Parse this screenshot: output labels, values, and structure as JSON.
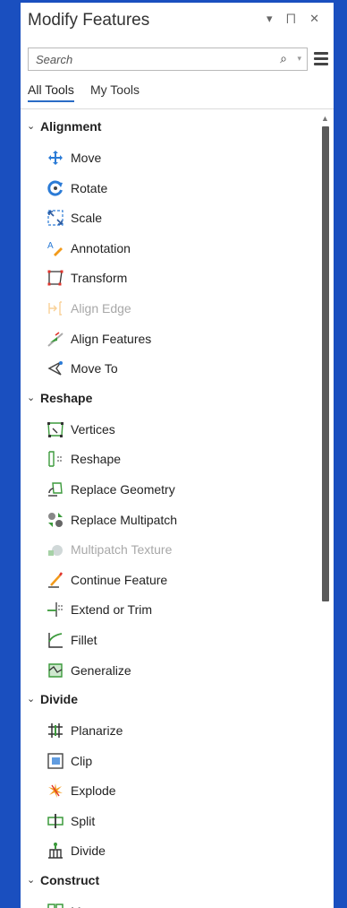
{
  "pane": {
    "title": "Modify Features",
    "title_controls": "▾ ⨅ ✕"
  },
  "search": {
    "placeholder": "Search",
    "search_glyph": "⌕",
    "drop_glyph": "▾"
  },
  "tabs": [
    {
      "label": "All Tools",
      "active": true
    },
    {
      "label": "My Tools",
      "active": false
    }
  ],
  "groups": [
    {
      "label": "Alignment",
      "items": [
        {
          "label": "Move",
          "icon": "move-icon",
          "disabled": false
        },
        {
          "label": "Rotate",
          "icon": "rotate-icon",
          "disabled": false
        },
        {
          "label": "Scale",
          "icon": "scale-icon",
          "disabled": false
        },
        {
          "label": "Annotation",
          "icon": "annotation-icon",
          "disabled": false
        },
        {
          "label": "Transform",
          "icon": "transform-icon",
          "disabled": false
        },
        {
          "label": "Align Edge",
          "icon": "align-edge-icon",
          "disabled": true
        },
        {
          "label": "Align Features",
          "icon": "align-features-icon",
          "disabled": false
        },
        {
          "label": "Move To",
          "icon": "move-to-icon",
          "disabled": false
        }
      ]
    },
    {
      "label": "Reshape",
      "items": [
        {
          "label": "Vertices",
          "icon": "vertices-icon",
          "disabled": false
        },
        {
          "label": "Reshape",
          "icon": "reshape-icon",
          "disabled": false
        },
        {
          "label": "Replace Geometry",
          "icon": "replace-geometry-icon",
          "disabled": false
        },
        {
          "label": "Replace Multipatch",
          "icon": "replace-multipatch-icon",
          "disabled": false
        },
        {
          "label": "Multipatch Texture",
          "icon": "multipatch-texture-icon",
          "disabled": true
        },
        {
          "label": "Continue Feature",
          "icon": "continue-feature-icon",
          "disabled": false
        },
        {
          "label": "Extend or Trim",
          "icon": "extend-trim-icon",
          "disabled": false
        },
        {
          "label": "Fillet",
          "icon": "fillet-icon",
          "disabled": false
        },
        {
          "label": "Generalize",
          "icon": "generalize-icon",
          "disabled": false
        }
      ]
    },
    {
      "label": "Divide",
      "items": [
        {
          "label": "Planarize",
          "icon": "planarize-icon",
          "disabled": false
        },
        {
          "label": "Clip",
          "icon": "clip-icon",
          "disabled": false
        },
        {
          "label": "Explode",
          "icon": "explode-icon",
          "disabled": false
        },
        {
          "label": "Split",
          "icon": "split-icon",
          "disabled": false
        },
        {
          "label": "Divide",
          "icon": "divide-icon",
          "disabled": false
        }
      ]
    },
    {
      "label": "Construct",
      "items": [
        {
          "label": "Merge",
          "icon": "merge-icon",
          "disabled": false
        }
      ]
    }
  ],
  "colors": {
    "background": "#1a4fbf",
    "tab_underline": "#2a6cc5",
    "icon_blue": "#2b7bd6",
    "icon_red": "#e0342c",
    "icon_green": "#3b9a3b",
    "icon_orange": "#f29a1a",
    "scroll_thumb": "#5a5a5a"
  }
}
